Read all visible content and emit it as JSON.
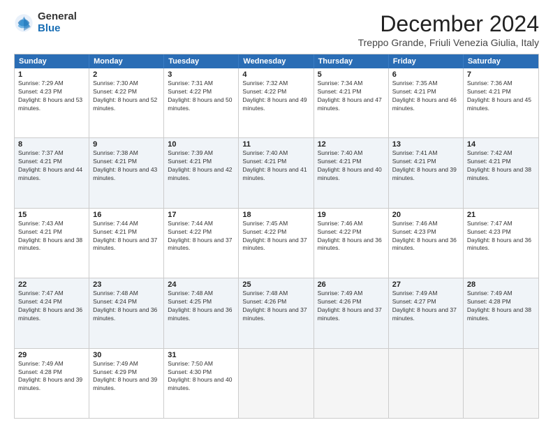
{
  "logo": {
    "general": "General",
    "blue": "Blue"
  },
  "header": {
    "month": "December 2024",
    "location": "Treppo Grande, Friuli Venezia Giulia, Italy"
  },
  "days": [
    "Sunday",
    "Monday",
    "Tuesday",
    "Wednesday",
    "Thursday",
    "Friday",
    "Saturday"
  ],
  "rows": [
    [
      {
        "day": "1",
        "sunrise": "7:29 AM",
        "sunset": "4:23 PM",
        "daylight": "8 hours and 53 minutes."
      },
      {
        "day": "2",
        "sunrise": "7:30 AM",
        "sunset": "4:22 PM",
        "daylight": "8 hours and 52 minutes."
      },
      {
        "day": "3",
        "sunrise": "7:31 AM",
        "sunset": "4:22 PM",
        "daylight": "8 hours and 50 minutes."
      },
      {
        "day": "4",
        "sunrise": "7:32 AM",
        "sunset": "4:22 PM",
        "daylight": "8 hours and 49 minutes."
      },
      {
        "day": "5",
        "sunrise": "7:34 AM",
        "sunset": "4:21 PM",
        "daylight": "8 hours and 47 minutes."
      },
      {
        "day": "6",
        "sunrise": "7:35 AM",
        "sunset": "4:21 PM",
        "daylight": "8 hours and 46 minutes."
      },
      {
        "day": "7",
        "sunrise": "7:36 AM",
        "sunset": "4:21 PM",
        "daylight": "8 hours and 45 minutes."
      }
    ],
    [
      {
        "day": "8",
        "sunrise": "7:37 AM",
        "sunset": "4:21 PM",
        "daylight": "8 hours and 44 minutes."
      },
      {
        "day": "9",
        "sunrise": "7:38 AM",
        "sunset": "4:21 PM",
        "daylight": "8 hours and 43 minutes."
      },
      {
        "day": "10",
        "sunrise": "7:39 AM",
        "sunset": "4:21 PM",
        "daylight": "8 hours and 42 minutes."
      },
      {
        "day": "11",
        "sunrise": "7:40 AM",
        "sunset": "4:21 PM",
        "daylight": "8 hours and 41 minutes."
      },
      {
        "day": "12",
        "sunrise": "7:40 AM",
        "sunset": "4:21 PM",
        "daylight": "8 hours and 40 minutes."
      },
      {
        "day": "13",
        "sunrise": "7:41 AM",
        "sunset": "4:21 PM",
        "daylight": "8 hours and 39 minutes."
      },
      {
        "day": "14",
        "sunrise": "7:42 AM",
        "sunset": "4:21 PM",
        "daylight": "8 hours and 38 minutes."
      }
    ],
    [
      {
        "day": "15",
        "sunrise": "7:43 AM",
        "sunset": "4:21 PM",
        "daylight": "8 hours and 38 minutes."
      },
      {
        "day": "16",
        "sunrise": "7:44 AM",
        "sunset": "4:21 PM",
        "daylight": "8 hours and 37 minutes."
      },
      {
        "day": "17",
        "sunrise": "7:44 AM",
        "sunset": "4:22 PM",
        "daylight": "8 hours and 37 minutes."
      },
      {
        "day": "18",
        "sunrise": "7:45 AM",
        "sunset": "4:22 PM",
        "daylight": "8 hours and 37 minutes."
      },
      {
        "day": "19",
        "sunrise": "7:46 AM",
        "sunset": "4:22 PM",
        "daylight": "8 hours and 36 minutes."
      },
      {
        "day": "20",
        "sunrise": "7:46 AM",
        "sunset": "4:23 PM",
        "daylight": "8 hours and 36 minutes."
      },
      {
        "day": "21",
        "sunrise": "7:47 AM",
        "sunset": "4:23 PM",
        "daylight": "8 hours and 36 minutes."
      }
    ],
    [
      {
        "day": "22",
        "sunrise": "7:47 AM",
        "sunset": "4:24 PM",
        "daylight": "8 hours and 36 minutes."
      },
      {
        "day": "23",
        "sunrise": "7:48 AM",
        "sunset": "4:24 PM",
        "daylight": "8 hours and 36 minutes."
      },
      {
        "day": "24",
        "sunrise": "7:48 AM",
        "sunset": "4:25 PM",
        "daylight": "8 hours and 36 minutes."
      },
      {
        "day": "25",
        "sunrise": "7:48 AM",
        "sunset": "4:26 PM",
        "daylight": "8 hours and 37 minutes."
      },
      {
        "day": "26",
        "sunrise": "7:49 AM",
        "sunset": "4:26 PM",
        "daylight": "8 hours and 37 minutes."
      },
      {
        "day": "27",
        "sunrise": "7:49 AM",
        "sunset": "4:27 PM",
        "daylight": "8 hours and 37 minutes."
      },
      {
        "day": "28",
        "sunrise": "7:49 AM",
        "sunset": "4:28 PM",
        "daylight": "8 hours and 38 minutes."
      }
    ],
    [
      {
        "day": "29",
        "sunrise": "7:49 AM",
        "sunset": "4:28 PM",
        "daylight": "8 hours and 39 minutes."
      },
      {
        "day": "30",
        "sunrise": "7:49 AM",
        "sunset": "4:29 PM",
        "daylight": "8 hours and 39 minutes."
      },
      {
        "day": "31",
        "sunrise": "7:50 AM",
        "sunset": "4:30 PM",
        "daylight": "8 hours and 40 minutes."
      },
      null,
      null,
      null,
      null
    ]
  ]
}
